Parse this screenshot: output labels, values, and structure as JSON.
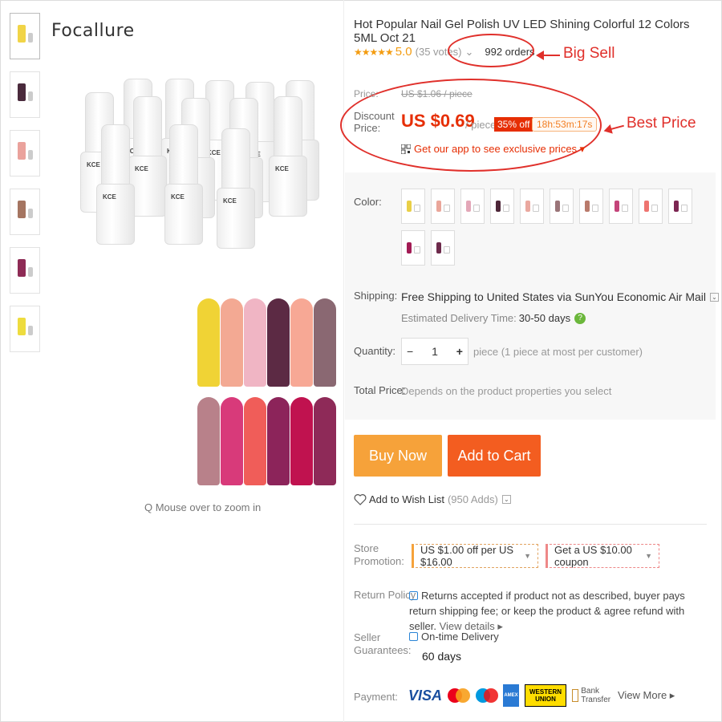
{
  "brand": "Focallure",
  "zoom_hint": "Q Mouse over to zoom in",
  "product": {
    "title": "Hot Popular Nail Gel Polish UV LED Shining Colorful 12 Colors 5ML Oct 21",
    "stars": "★★★★★",
    "rating": "5.0",
    "votes": "(35 votes)",
    "votes_caret": "⌄",
    "orders": "992 orders"
  },
  "annotations": {
    "big_sell": "Big Sell",
    "best_price": "Best Price"
  },
  "price": {
    "label": "Price:",
    "original": "US $1.06 / piece",
    "discount_label": "Discount Price:",
    "discount_value": "US $0.69",
    "per_piece": "/ piece",
    "off_badge": "35% off",
    "timer": "18h:53m:17s",
    "app_promo": "Get our app to see exclusive prices ▾"
  },
  "bottle_label": "KCE",
  "thumbnail_colors": [
    "#f1d447",
    "#4a2a3c",
    "#eaa29c",
    "#a57561",
    "#8e2b55",
    "#eedc3e"
  ],
  "image_swatches_top": [
    "#f0d335",
    "#f3a993",
    "#f0b5c4",
    "#5c2a44",
    "#f7a895",
    "#8a6872"
  ],
  "image_swatches_bottom": [
    "#b8818a",
    "#d83a7a",
    "#f05d59",
    "#8c245a",
    "#c0124f",
    "#8e2a58"
  ],
  "color_section": {
    "label": "Color:",
    "options": [
      "#e9cf47",
      "#eaa69a",
      "#e3a7b8",
      "#4d2638",
      "#eaa89f",
      "#9a7478",
      "#b97a6b",
      "#c4447a",
      "#ee7470",
      "#7c2652",
      "#a21b54",
      "#6d2a4b"
    ]
  },
  "shipping": {
    "label": "Shipping:",
    "main": "Free Shipping to United States via SunYou Economic Air Mail",
    "estimate_label": "Estimated Delivery Time:",
    "estimate_value": "30-50 days"
  },
  "quantity": {
    "label": "Quantity:",
    "minus": "−",
    "value": "1",
    "plus": "+",
    "note": "piece (1 piece at most per customer)"
  },
  "total": {
    "label": "Total Price:",
    "note": "Depends on the product properties you select"
  },
  "buttons": {
    "buy_now": "Buy Now",
    "add_to_cart": "Add to Cart"
  },
  "wishlist": {
    "label": "Add to Wish List",
    "count": "(950 Adds)"
  },
  "store_promotion": {
    "label": "Store Promotion:",
    "coupon1": "US $1.00 off per US $16.00",
    "coupon2": "Get a US $10.00 coupon"
  },
  "return_policy": {
    "label": "Return Policy",
    "text": "Returns accepted if product not as described, buyer pays return shipping fee; or keep the product & agree refund with seller.",
    "view_details": "View details ▸"
  },
  "seller_guarantee": {
    "label": "Seller Guarantees:",
    "item": "On-time Delivery",
    "days": "60 days"
  },
  "payment": {
    "label": "Payment:",
    "visa": "VISA",
    "mastercard": "MasterCard",
    "maestro": "Maestro",
    "amex": "AMEX",
    "western_union": "WESTERN UNION",
    "bank": "Bank Transfer",
    "view_more": "View More ▸"
  }
}
